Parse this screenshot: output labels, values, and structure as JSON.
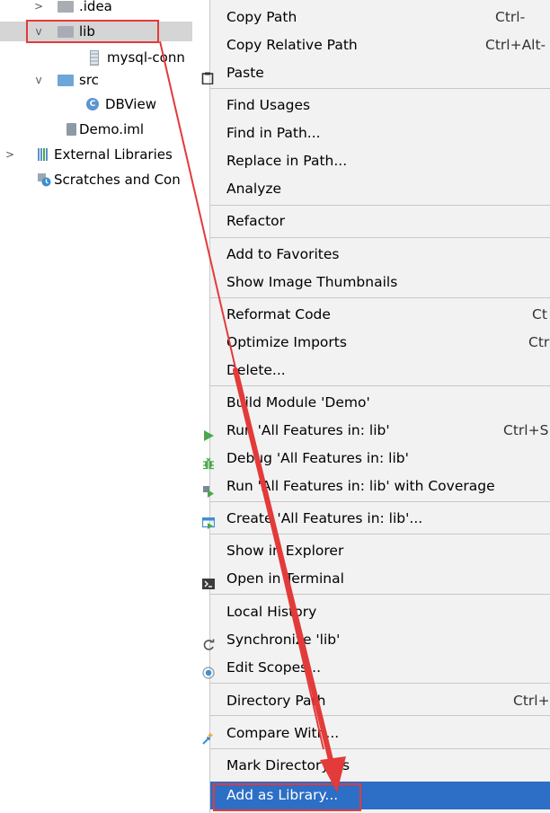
{
  "project_tree": {
    "items": [
      {
        "label": ".idea",
        "arrow": ">",
        "icon": "folder-icon"
      },
      {
        "label": "lib",
        "arrow": "v",
        "icon": "folder-icon"
      },
      {
        "label": "mysql-conn",
        "icon": "jar-icon"
      },
      {
        "label": "src",
        "arrow": "v",
        "icon": "source-folder-icon"
      },
      {
        "label": "DBView",
        "icon": "class-icon",
        "icon_text": "C"
      },
      {
        "label": "Demo.iml",
        "icon": "module-file-icon"
      },
      {
        "label": "External Libraries",
        "arrow": ">",
        "icon": "libraries-icon"
      },
      {
        "label": "Scratches and Con",
        "icon": "scratches-icon"
      }
    ]
  },
  "context_menu": {
    "items": [
      {
        "label": "Copy Path",
        "shortcut": "Ctrl-"
      },
      {
        "label": "Copy Relative Path",
        "shortcut": "Ctrl+Alt-"
      },
      {
        "label": "Paste",
        "icon": "paste-icon"
      },
      {
        "label": "Find Usages"
      },
      {
        "label": "Find in Path..."
      },
      {
        "label": "Replace in Path..."
      },
      {
        "label": "Analyze"
      },
      {
        "label": "Refactor"
      },
      {
        "label": "Add to Favorites"
      },
      {
        "label": "Show Image Thumbnails"
      },
      {
        "label": "Reformat Code",
        "shortcut": "Ct"
      },
      {
        "label": "Optimize Imports",
        "shortcut": "Ctr"
      },
      {
        "label": "Delete..."
      },
      {
        "label": "Build Module 'Demo'"
      },
      {
        "label": "Run 'All Features in: lib'",
        "shortcut": "Ctrl+S",
        "icon": "run-icon"
      },
      {
        "label": "Debug 'All Features in: lib'",
        "icon": "debug-icon"
      },
      {
        "label": "Run 'All Features in: lib' with Coverage",
        "icon": "coverage-icon"
      },
      {
        "label": "Create 'All Features in: lib'...",
        "icon": "create-config-icon"
      },
      {
        "label": "Show in Explorer"
      },
      {
        "label": "Open in Terminal",
        "icon": "terminal-icon"
      },
      {
        "label": "Local History"
      },
      {
        "label": "Synchronize 'lib'",
        "icon": "sync-icon"
      },
      {
        "label": "Edit Scopes...",
        "icon": "scopes-icon"
      },
      {
        "label": "Directory Path",
        "shortcut": "Ctrl+"
      },
      {
        "label": "Compare With...",
        "icon": "compare-icon"
      },
      {
        "label": "Mark Directory as"
      },
      {
        "label": "Add as Library..."
      }
    ]
  },
  "colors": {
    "menu_background": "#f2f2f2",
    "highlight": "#2d6ec6",
    "annotation_red": "#e33a3a",
    "run_green": "#4aa84a"
  }
}
